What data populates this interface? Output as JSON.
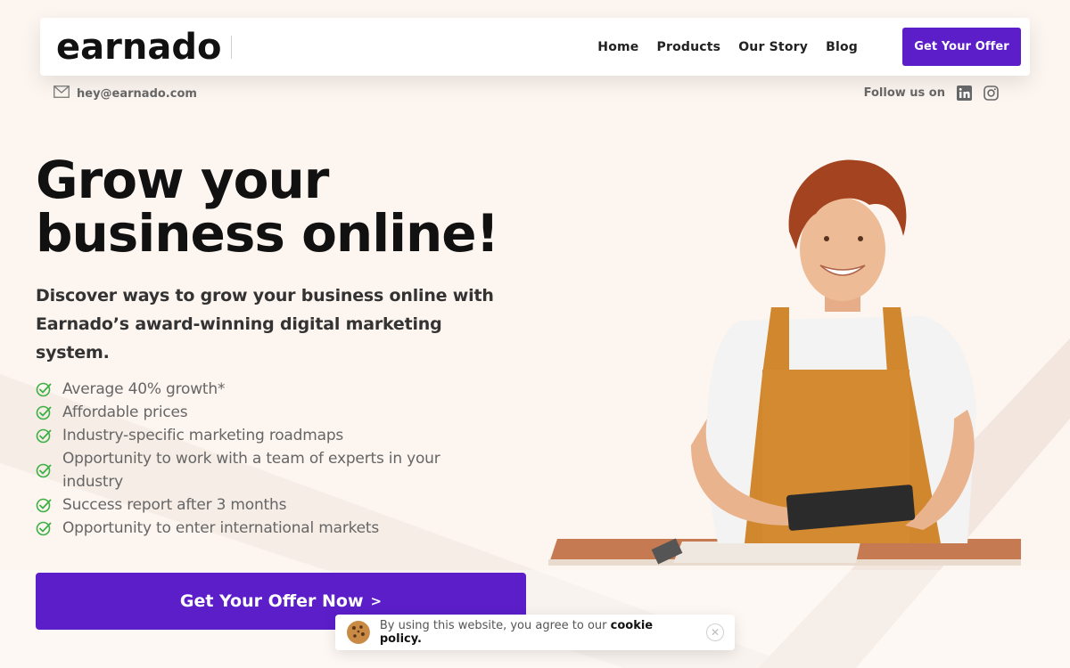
{
  "header": {
    "logo_text": "earnado",
    "nav": [
      "Home",
      "Products",
      "Our Story",
      "Blog"
    ],
    "cta_label": "Get Your Offer"
  },
  "contact": {
    "email": "hey@earnado.com",
    "follow_label": "Follow us on",
    "social_icons": [
      "linkedin-icon",
      "instagram-icon"
    ]
  },
  "hero": {
    "title_line1": "Grow your",
    "title_line2": "business online!",
    "subtitle": "Discover ways to grow your business online with Earnado’s award-winning digital marketing system.",
    "features": [
      "Average 40% growth*",
      "Affordable prices",
      "Industry-specific marketing roadmaps",
      "Opportunity to work with a team of experts in your industry",
      "Success report after 3 months",
      "Opportunity to enter international markets"
    ],
    "cta_label": "Get Your Offer Now",
    "cta_chevron": ">"
  },
  "cookie": {
    "text": "By using this website, you agree to our",
    "link": "cookie policy.",
    "close": "✕"
  },
  "colors": {
    "accent": "#5b1ec9",
    "check": "#3cb043",
    "background": "#fdf5f0"
  }
}
